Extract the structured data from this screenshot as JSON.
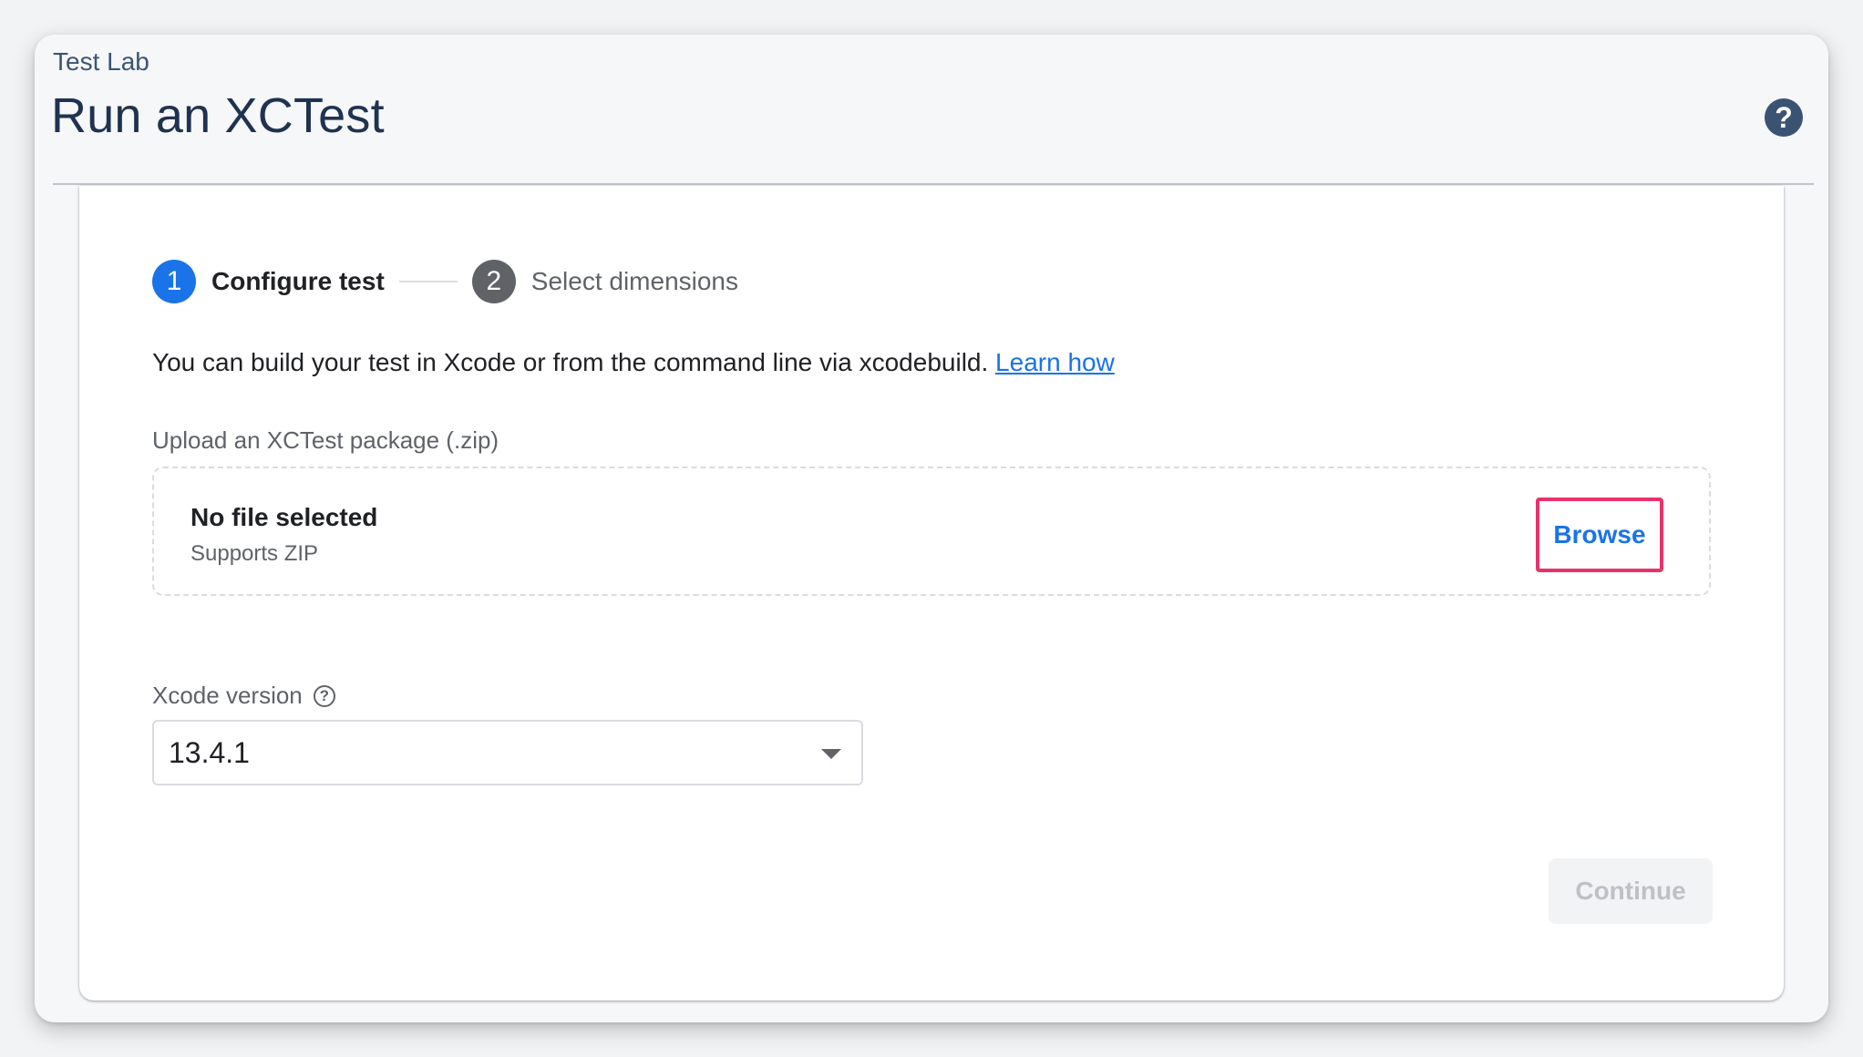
{
  "header": {
    "breadcrumb": "Test Lab",
    "title": "Run an XCTest",
    "help_icon_glyph": "?"
  },
  "stepper": {
    "steps": [
      {
        "number": "1",
        "label": "Configure test",
        "state": "active"
      },
      {
        "number": "2",
        "label": "Select dimensions",
        "state": "inactive"
      }
    ]
  },
  "intro": {
    "text": "You can build your test in Xcode or from the command line via xcodebuild. ",
    "link_label": "Learn how"
  },
  "upload": {
    "label": "Upload an XCTest package (.zip)",
    "file_status": "No file selected",
    "hint": "Supports ZIP",
    "browse_label": "Browse"
  },
  "xcode": {
    "label": "Xcode version",
    "info_icon_glyph": "?",
    "selected_value": "13.4.1"
  },
  "actions": {
    "continue_label": "Continue",
    "continue_enabled": false
  },
  "colors": {
    "accent": "#1a73e8",
    "title": "#1f3350",
    "highlight_border": "#e8336b",
    "help_icon_bg": "#3b5373"
  }
}
